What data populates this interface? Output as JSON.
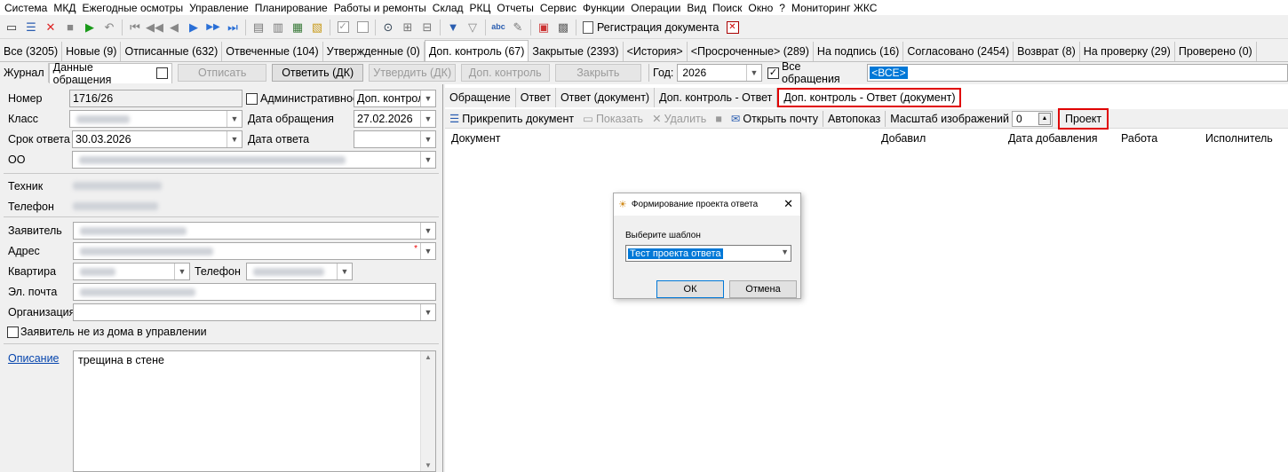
{
  "menu": [
    "Система",
    "МКД",
    "Ежегодные осмотры",
    "Управление",
    "Планирование",
    "Работы и ремонты",
    "Склад",
    "РКЦ",
    "Отчеты",
    "Сервис",
    "Функции",
    "Операции",
    "Вид",
    "Поиск",
    "Окно",
    "?",
    "Мониторинг ЖКС"
  ],
  "toolbar": {
    "reg_doc_label": "Регистрация документа"
  },
  "tabs": [
    {
      "label": "Все (3205)"
    },
    {
      "label": "Новые (9)"
    },
    {
      "label": "Отписанные (632)"
    },
    {
      "label": "Отвеченные (104)"
    },
    {
      "label": "Утвержденные (0)"
    },
    {
      "label": "Доп. контроль (67)",
      "active": true
    },
    {
      "label": "Закрытые (2393)"
    },
    {
      "label": "<История>"
    },
    {
      "label": "<Просроченные> (289)"
    },
    {
      "label": "На подпись (16)"
    },
    {
      "label": "Согласовано (2454)"
    },
    {
      "label": "Возврат (8)"
    },
    {
      "label": "На проверку (29)"
    },
    {
      "label": "Проверено (0)"
    }
  ],
  "row2": {
    "journal": "Журнал",
    "data_tab": "Данные обращения",
    "btn_assign": "Отписать",
    "btn_answer": "Ответить (ДК)",
    "btn_approve": "Утвердить (ДК)",
    "btn_control": "Доп. контроль",
    "btn_close": "Закрыть",
    "year_label": "Год:",
    "year_value": "2026",
    "all_label": "Все обращения",
    "filter_value": "<ВСЕ>"
  },
  "form": {
    "number_label": "Номер",
    "number_value": "1716/26",
    "admin_label": "Административное",
    "admin_value": "Доп. контроль",
    "class_label": "Класс",
    "date_label": "Дата обращения",
    "date_value": "27.02.2026",
    "due_label": "Срок ответа",
    "due_value": "30.03.2026",
    "answer_date_label": "Дата ответа",
    "oo_label": "ОО",
    "tech_label": "Техник",
    "phone_label": "Телефон",
    "applicant_label": "Заявитель",
    "address_label": "Адрес",
    "flat_label": "Квартира",
    "phone2_label": "Телефон",
    "email_label": "Эл. почта",
    "org_label": "Организация",
    "not_home_label": "Заявитель не из дома в управлении",
    "desc_label": "Описание",
    "desc_value": "трещина в стене"
  },
  "right": {
    "tabs": [
      {
        "label": "Обращение"
      },
      {
        "label": "Ответ"
      },
      {
        "label": "Ответ (документ)"
      },
      {
        "label": "Доп. контроль - Ответ"
      },
      {
        "label": "Доп. контроль - Ответ (документ)",
        "active": true
      }
    ],
    "tool": {
      "attach": "Прикрепить документ",
      "show": "Показать",
      "delete": "Удалить",
      "mail": "Открыть почту",
      "autoshow": "Автопоказ",
      "scale_label": "Масштаб изображений",
      "scale_value": "0",
      "project": "Проект"
    },
    "columns": [
      "Документ",
      "Добавил",
      "Дата добавления",
      "Работа",
      "Исполнитель"
    ]
  },
  "dialog": {
    "title": "Формирование проекта ответа",
    "prompt": "Выберите шаблон",
    "template_value": "Тест проекта ответа",
    "ok": "ОК",
    "cancel": "Отмена"
  },
  "colors": {
    "highlight_red": "#e00000",
    "selection_blue": "#0078d7"
  }
}
